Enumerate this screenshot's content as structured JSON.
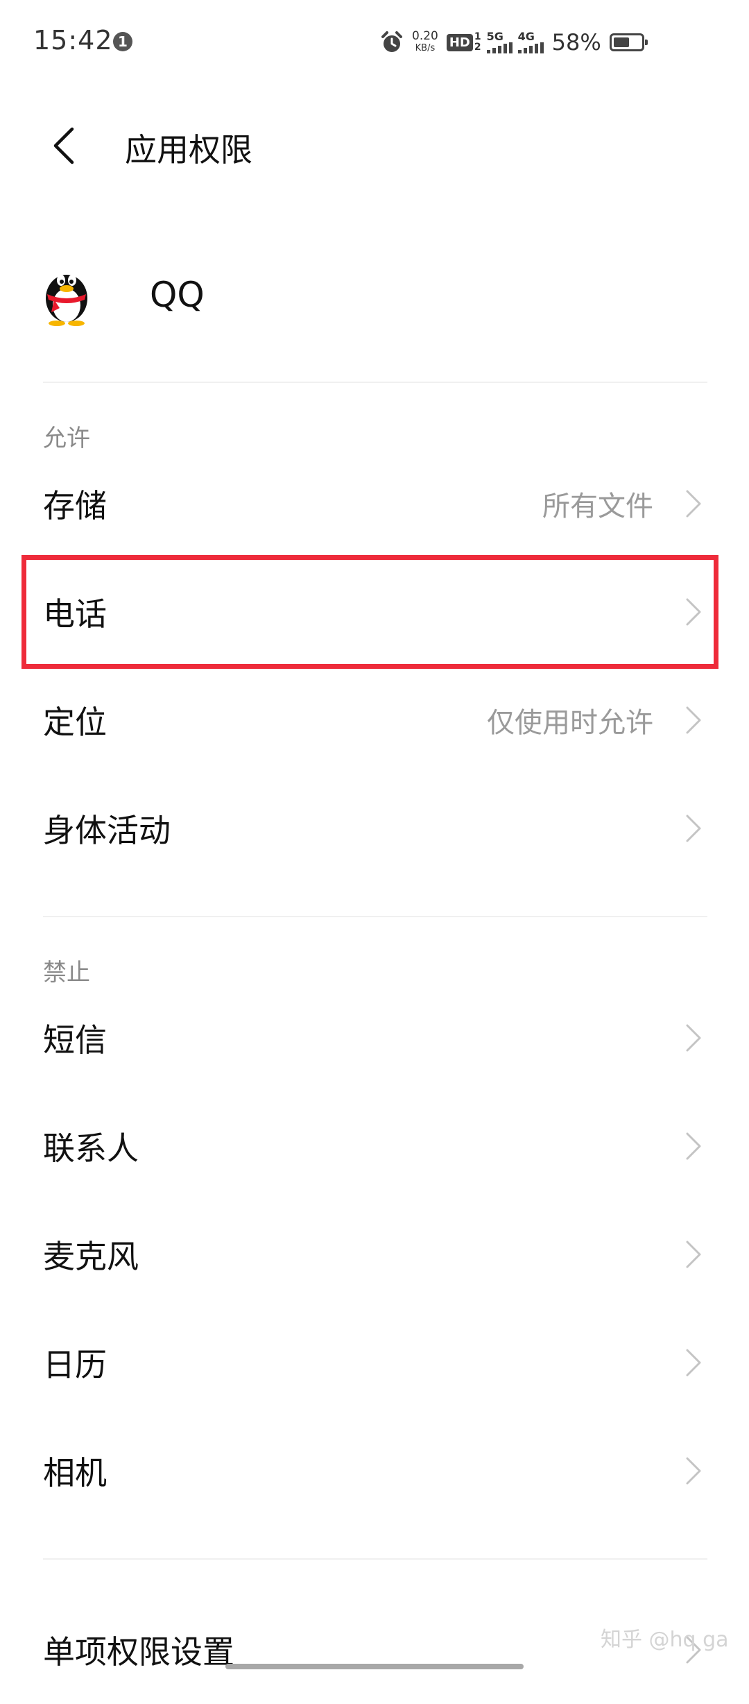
{
  "status_bar": {
    "time": "15:42",
    "notification_badge": "1",
    "net_speed_value": "0.20",
    "net_speed_unit": "KB/s",
    "hd_label": "HD",
    "sim1": "1",
    "sim2": "2",
    "net1": "5G",
    "net2": "4G",
    "battery_pct": "58%",
    "battery_level": 0.58
  },
  "header": {
    "title": "应用权限"
  },
  "app": {
    "name": "QQ",
    "icon": "qq-penguin-icon"
  },
  "sections": {
    "allow_label": "允许",
    "deny_label": "禁止"
  },
  "allowed": [
    {
      "label": "存储",
      "value": "所有文件"
    },
    {
      "label": "电话",
      "value": ""
    },
    {
      "label": "定位",
      "value": "仅使用时允许"
    },
    {
      "label": "身体活动",
      "value": ""
    }
  ],
  "denied": [
    {
      "label": "短信",
      "value": ""
    },
    {
      "label": "联系人",
      "value": ""
    },
    {
      "label": "麦克风",
      "value": ""
    },
    {
      "label": "日历",
      "value": ""
    },
    {
      "label": "相机",
      "value": ""
    }
  ],
  "footer": {
    "single_permission_label": "单项权限设置"
  },
  "watermark": "知乎 @hq ga",
  "colors": {
    "highlight": "#ee2b3a",
    "secondary_text": "#9a9a9a",
    "section_label": "#8a8a8a"
  }
}
